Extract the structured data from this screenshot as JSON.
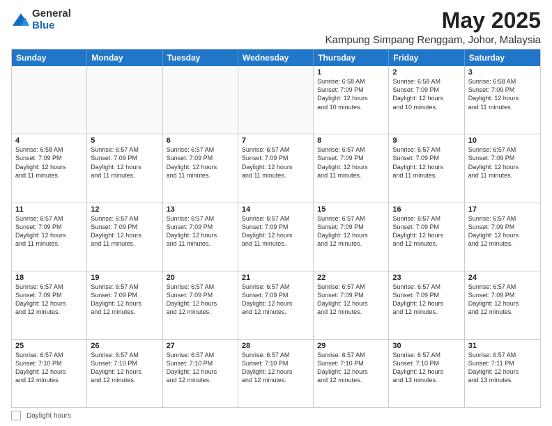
{
  "logo": {
    "general": "General",
    "blue": "Blue"
  },
  "title": "May 2025",
  "location": "Kampung Simpang Renggam, Johor, Malaysia",
  "footer": {
    "label": "Daylight hours"
  },
  "headers": [
    "Sunday",
    "Monday",
    "Tuesday",
    "Wednesday",
    "Thursday",
    "Friday",
    "Saturday"
  ],
  "rows": [
    [
      {
        "day": "",
        "info": ""
      },
      {
        "day": "",
        "info": ""
      },
      {
        "day": "",
        "info": ""
      },
      {
        "day": "",
        "info": ""
      },
      {
        "day": "1",
        "info": "Sunrise: 6:58 AM\nSunset: 7:09 PM\nDaylight: 12 hours\nand 10 minutes."
      },
      {
        "day": "2",
        "info": "Sunrise: 6:58 AM\nSunset: 7:09 PM\nDaylight: 12 hours\nand 10 minutes."
      },
      {
        "day": "3",
        "info": "Sunrise: 6:58 AM\nSunset: 7:09 PM\nDaylight: 12 hours\nand 11 minutes."
      }
    ],
    [
      {
        "day": "4",
        "info": "Sunrise: 6:58 AM\nSunset: 7:09 PM\nDaylight: 12 hours\nand 11 minutes."
      },
      {
        "day": "5",
        "info": "Sunrise: 6:57 AM\nSunset: 7:09 PM\nDaylight: 12 hours\nand 11 minutes."
      },
      {
        "day": "6",
        "info": "Sunrise: 6:57 AM\nSunset: 7:09 PM\nDaylight: 12 hours\nand 11 minutes."
      },
      {
        "day": "7",
        "info": "Sunrise: 6:57 AM\nSunset: 7:09 PM\nDaylight: 12 hours\nand 11 minutes."
      },
      {
        "day": "8",
        "info": "Sunrise: 6:57 AM\nSunset: 7:09 PM\nDaylight: 12 hours\nand 11 minutes."
      },
      {
        "day": "9",
        "info": "Sunrise: 6:57 AM\nSunset: 7:09 PM\nDaylight: 12 hours\nand 11 minutes."
      },
      {
        "day": "10",
        "info": "Sunrise: 6:57 AM\nSunset: 7:09 PM\nDaylight: 12 hours\nand 11 minutes."
      }
    ],
    [
      {
        "day": "11",
        "info": "Sunrise: 6:57 AM\nSunset: 7:09 PM\nDaylight: 12 hours\nand 11 minutes."
      },
      {
        "day": "12",
        "info": "Sunrise: 6:57 AM\nSunset: 7:09 PM\nDaylight: 12 hours\nand 11 minutes."
      },
      {
        "day": "13",
        "info": "Sunrise: 6:57 AM\nSunset: 7:09 PM\nDaylight: 12 hours\nand 11 minutes."
      },
      {
        "day": "14",
        "info": "Sunrise: 6:57 AM\nSunset: 7:09 PM\nDaylight: 12 hours\nand 11 minutes."
      },
      {
        "day": "15",
        "info": "Sunrise: 6:57 AM\nSunset: 7:09 PM\nDaylight: 12 hours\nand 12 minutes."
      },
      {
        "day": "16",
        "info": "Sunrise: 6:57 AM\nSunset: 7:09 PM\nDaylight: 12 hours\nand 12 minutes."
      },
      {
        "day": "17",
        "info": "Sunrise: 6:57 AM\nSunset: 7:09 PM\nDaylight: 12 hours\nand 12 minutes."
      }
    ],
    [
      {
        "day": "18",
        "info": "Sunrise: 6:57 AM\nSunset: 7:09 PM\nDaylight: 12 hours\nand 12 minutes."
      },
      {
        "day": "19",
        "info": "Sunrise: 6:57 AM\nSunset: 7:09 PM\nDaylight: 12 hours\nand 12 minutes."
      },
      {
        "day": "20",
        "info": "Sunrise: 6:57 AM\nSunset: 7:09 PM\nDaylight: 12 hours\nand 12 minutes."
      },
      {
        "day": "21",
        "info": "Sunrise: 6:57 AM\nSunset: 7:09 PM\nDaylight: 12 hours\nand 12 minutes."
      },
      {
        "day": "22",
        "info": "Sunrise: 6:57 AM\nSunset: 7:09 PM\nDaylight: 12 hours\nand 12 minutes."
      },
      {
        "day": "23",
        "info": "Sunrise: 6:57 AM\nSunset: 7:09 PM\nDaylight: 12 hours\nand 12 minutes."
      },
      {
        "day": "24",
        "info": "Sunrise: 6:57 AM\nSunset: 7:09 PM\nDaylight: 12 hours\nand 12 minutes."
      }
    ],
    [
      {
        "day": "25",
        "info": "Sunrise: 6:57 AM\nSunset: 7:10 PM\nDaylight: 12 hours\nand 12 minutes."
      },
      {
        "day": "26",
        "info": "Sunrise: 6:57 AM\nSunset: 7:10 PM\nDaylight: 12 hours\nand 12 minutes."
      },
      {
        "day": "27",
        "info": "Sunrise: 6:57 AM\nSunset: 7:10 PM\nDaylight: 12 hours\nand 12 minutes."
      },
      {
        "day": "28",
        "info": "Sunrise: 6:57 AM\nSunset: 7:10 PM\nDaylight: 12 hours\nand 12 minutes."
      },
      {
        "day": "29",
        "info": "Sunrise: 6:57 AM\nSunset: 7:10 PM\nDaylight: 12 hours\nand 12 minutes."
      },
      {
        "day": "30",
        "info": "Sunrise: 6:57 AM\nSunset: 7:10 PM\nDaylight: 12 hours\nand 13 minutes."
      },
      {
        "day": "31",
        "info": "Sunrise: 6:57 AM\nSunset: 7:11 PM\nDaylight: 12 hours\nand 13 minutes."
      }
    ]
  ]
}
